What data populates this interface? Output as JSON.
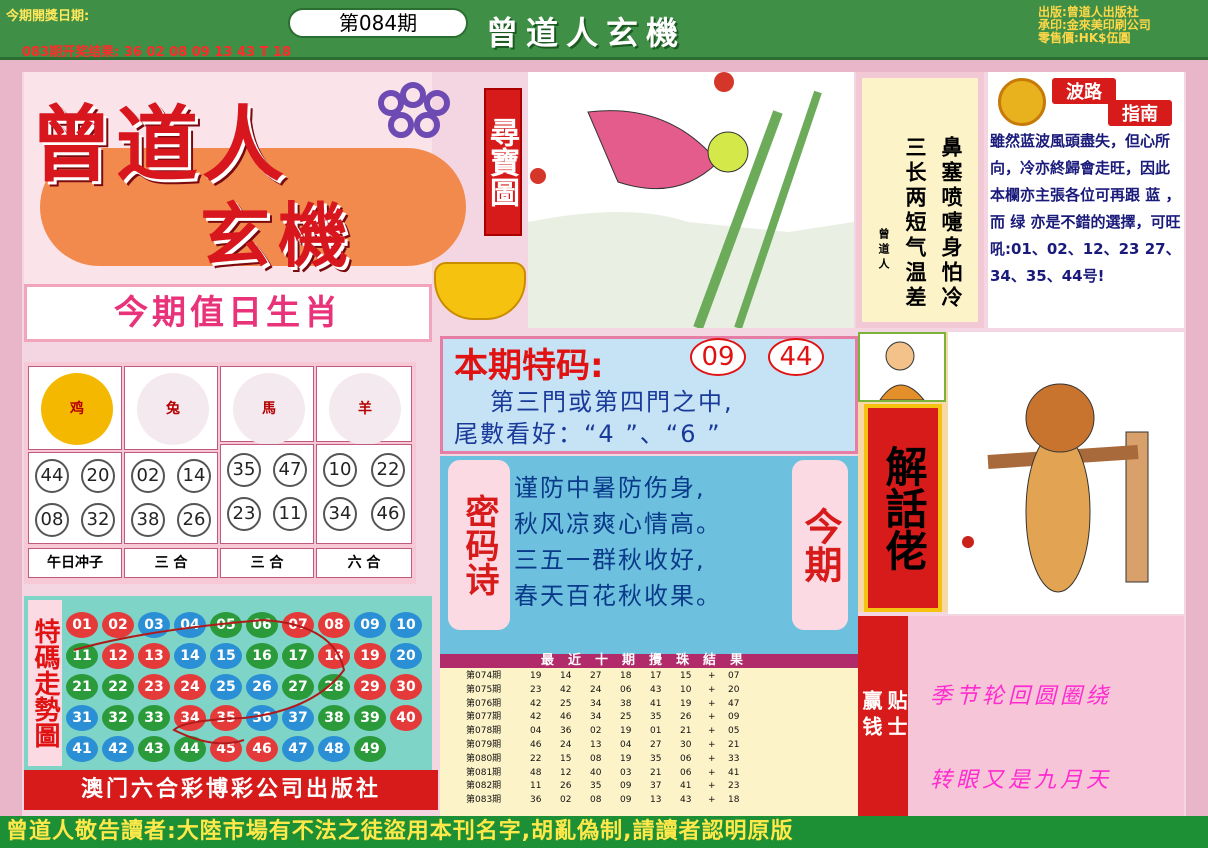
{
  "top": {
    "date_label": "今期開獎日期:",
    "issue": "第084期",
    "title": "曾道人玄機",
    "last_result": "083期开奖结果: 36 02 08 09 13 43 T 18",
    "publisher": [
      "出版:曾道人出版社",
      "承印:金來美印刷公司",
      "零售價:HK$伍圓"
    ]
  },
  "logo": {
    "line1": "曾道人",
    "line2": "玄機",
    "side": "尋寶圖"
  },
  "poem_right": {
    "col1": "鼻塞喷嚏身怕冷",
    "col2": "三长两短气温差",
    "author": "曾道人"
  },
  "guide": {
    "title1": "波路",
    "title2": "指南",
    "text": "雖然蓝波風頭盡失，但心所向，冷亦終歸會走旺，因此本欄亦主張各位可再跟 蓝 ，而 绿 亦是不錯的選擇，可旺",
    "nums": "吼:01、02、12、23 27、34、35、44号!"
  },
  "zodiac": {
    "heading": "今期值日生肖",
    "animals": [
      {
        "name": "鸡",
        "nums": [
          "44",
          "20",
          "08",
          "32"
        ],
        "label": "午日冲子"
      },
      {
        "name": "兔",
        "nums": [
          "02",
          "14",
          "38",
          "26"
        ],
        "label": "三  合"
      },
      {
        "name": "馬",
        "nums": [
          "35",
          "47",
          "23",
          "11"
        ],
        "label": "三  合"
      },
      {
        "name": "羊",
        "nums": [
          "10",
          "22",
          "34",
          "46"
        ],
        "label": "六  合"
      }
    ]
  },
  "special": {
    "title": "本期特码:",
    "num1": "09",
    "num2": "44",
    "line1": "第三門或第四門之中,",
    "line2": "尾數看好：“4 ”、“6 ”"
  },
  "code_poem": {
    "left": "密码诗",
    "right": "今期",
    "lines": [
      "谨防中暑防伤身,",
      "秋风凉爽心情高。",
      "三五一群秋收好,",
      "春天百花秋收果。"
    ]
  },
  "jie": {
    "banner": "解話佬"
  },
  "trend": {
    "title": "特碼走勢圖",
    "rows": [
      [
        [
          "01",
          "r"
        ],
        [
          "02",
          "r"
        ],
        [
          "03",
          "b"
        ],
        [
          "04",
          "b"
        ],
        [
          "05",
          "g"
        ],
        [
          "06",
          "g"
        ],
        [
          "07",
          "r"
        ],
        [
          "08",
          "r"
        ],
        [
          "09",
          "b"
        ],
        [
          "10",
          "b"
        ]
      ],
      [
        [
          "11",
          "g"
        ],
        [
          "12",
          "r"
        ],
        [
          "13",
          "r"
        ],
        [
          "14",
          "b"
        ],
        [
          "15",
          "b"
        ],
        [
          "16",
          "g"
        ],
        [
          "17",
          "g"
        ],
        [
          "18",
          "r"
        ],
        [
          "19",
          "r"
        ],
        [
          "20",
          "b"
        ]
      ],
      [
        [
          "21",
          "g"
        ],
        [
          "22",
          "g"
        ],
        [
          "23",
          "r"
        ],
        [
          "24",
          "r"
        ],
        [
          "25",
          "b"
        ],
        [
          "26",
          "b"
        ],
        [
          "27",
          "g"
        ],
        [
          "28",
          "g"
        ],
        [
          "29",
          "r"
        ],
        [
          "30",
          "r"
        ]
      ],
      [
        [
          "31",
          "b"
        ],
        [
          "32",
          "g"
        ],
        [
          "33",
          "g"
        ],
        [
          "34",
          "r"
        ],
        [
          "35",
          "r"
        ],
        [
          "36",
          "b"
        ],
        [
          "37",
          "b"
        ],
        [
          "38",
          "g"
        ],
        [
          "39",
          "g"
        ],
        [
          "40",
          "r"
        ]
      ],
      [
        [
          "41",
          "b"
        ],
        [
          "42",
          "b"
        ],
        [
          "43",
          "g"
        ],
        [
          "44",
          "g"
        ],
        [
          "45",
          "r"
        ],
        [
          "46",
          "r"
        ],
        [
          "47",
          "b"
        ],
        [
          "48",
          "b"
        ],
        [
          "49",
          "g"
        ]
      ]
    ]
  },
  "macau_pub": "澳门六合彩博彩公司出版社",
  "history": {
    "heading": "最近十期攪珠結果",
    "rows": [
      [
        "第074期",
        "19",
        "14",
        "27",
        "18",
        "17",
        "15",
        "+",
        "07"
      ],
      [
        "第075期",
        "23",
        "42",
        "24",
        "06",
        "43",
        "10",
        "+",
        "20"
      ],
      [
        "第076期",
        "42",
        "25",
        "34",
        "38",
        "41",
        "19",
        "+",
        "47"
      ],
      [
        "第077期",
        "42",
        "46",
        "34",
        "25",
        "35",
        "26",
        "+",
        "09"
      ],
      [
        "第078期",
        "04",
        "36",
        "02",
        "19",
        "01",
        "21",
        "+",
        "05"
      ],
      [
        "第079期",
        "46",
        "24",
        "13",
        "04",
        "27",
        "30",
        "+",
        "21"
      ],
      [
        "第080期",
        "22",
        "15",
        "08",
        "19",
        "35",
        "06",
        "+",
        "33"
      ],
      [
        "第081期",
        "48",
        "12",
        "40",
        "03",
        "21",
        "06",
        "+",
        "41"
      ],
      [
        "第082期",
        "11",
        "26",
        "35",
        "09",
        "37",
        "41",
        "+",
        "23"
      ],
      [
        "第083期",
        "36",
        "02",
        "08",
        "09",
        "13",
        "43",
        "+",
        "18"
      ]
    ]
  },
  "win": {
    "left": "赢钱",
    "right": "贴士",
    "line1": "季节轮回圆圈绕",
    "line2": "转眼又是九月天"
  },
  "bottom": "曾道人敬告讀者:大陸市場有不法之徒盜用本刊名字,胡亂偽制,請讀者認明原版"
}
